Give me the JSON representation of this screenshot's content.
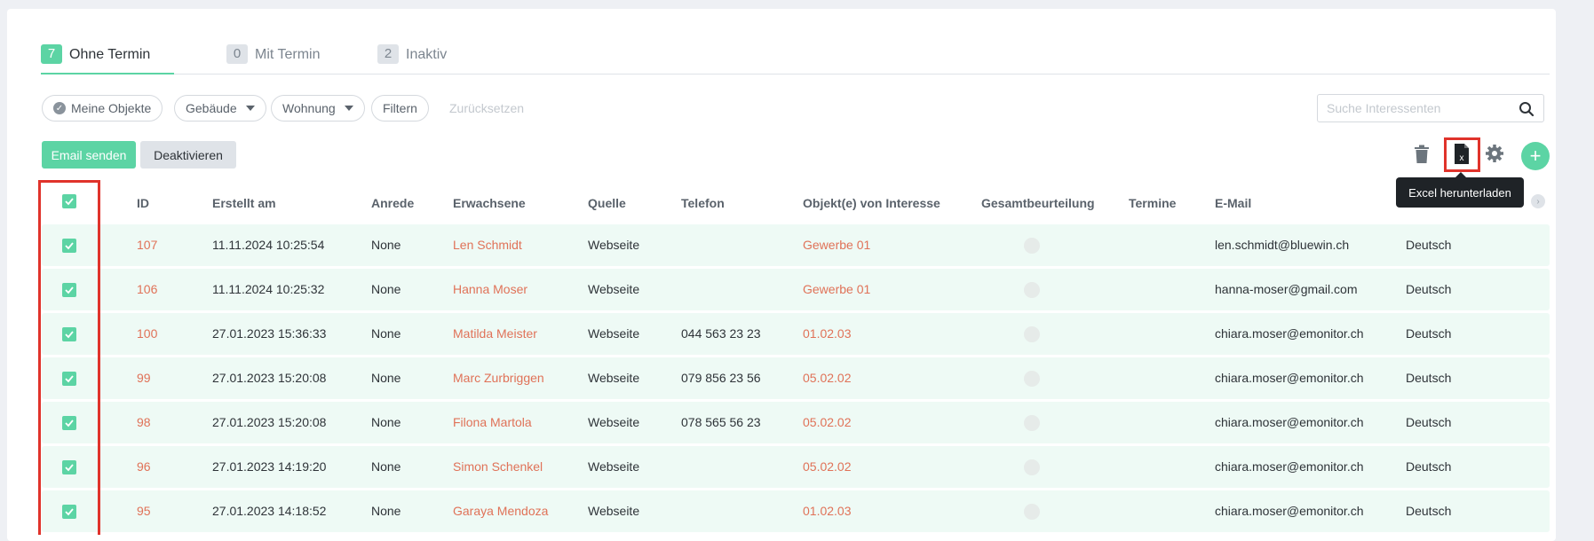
{
  "tabs": [
    {
      "count": "7",
      "label": "Ohne Termin",
      "active": true
    },
    {
      "count": "0",
      "label": "Mit Termin",
      "active": false
    },
    {
      "count": "2",
      "label": "Inaktiv",
      "active": false
    }
  ],
  "filters": {
    "my_objects": "Meine Objekte",
    "building": "Gebäude",
    "apartment": "Wohnung",
    "filter": "Filtern",
    "reset": "Zurücksetzen"
  },
  "search": {
    "placeholder": "Suche Interessenten",
    "value": ""
  },
  "actions": {
    "email": "Email senden",
    "deactivate": "Deaktivieren",
    "excel_tooltip": "Excel herunterladen"
  },
  "icons": {
    "delete": "trash-icon",
    "excel": "excel-file-icon",
    "settings": "gear-icon",
    "add": "plus-icon",
    "search": "search-icon"
  },
  "colors": {
    "accent": "#5cd4a4",
    "link": "#e07258",
    "highlight": "#e0332b",
    "row_bg": "#eefaf5"
  },
  "table": {
    "headers": [
      "ID",
      "Erstellt am",
      "Anrede",
      "Erwachsene",
      "Quelle",
      "Telefon",
      "Objekt(e) von Interesse",
      "Gesamtbeurteilung",
      "Termine",
      "E-Mail"
    ],
    "rows": [
      {
        "id": "107",
        "created": "11.11.2024 10:25:54",
        "salutation": "None",
        "adults": "Len Schmidt",
        "source": "Webseite",
        "phone": "",
        "objects": "Gewerbe 01",
        "appointments": "",
        "email": "len.schmidt@bluewin.ch",
        "language": "Deutsch"
      },
      {
        "id": "106",
        "created": "11.11.2024 10:25:32",
        "salutation": "None",
        "adults": "Hanna Moser",
        "source": "Webseite",
        "phone": "",
        "objects": "Gewerbe 01",
        "appointments": "",
        "email": "hanna-moser@gmail.com",
        "language": "Deutsch"
      },
      {
        "id": "100",
        "created": "27.01.2023 15:36:33",
        "salutation": "None",
        "adults": "Matilda Meister",
        "source": "Webseite",
        "phone": "044 563 23 23",
        "objects": "01.02.03",
        "appointments": "",
        "email": "chiara.moser@emonitor.ch",
        "language": "Deutsch"
      },
      {
        "id": "99",
        "created": "27.01.2023 15:20:08",
        "salutation": "None",
        "adults": "Marc Zurbriggen",
        "source": "Webseite",
        "phone": "079 856 23 56",
        "objects": "05.02.02",
        "appointments": "",
        "email": "chiara.moser@emonitor.ch",
        "language": "Deutsch"
      },
      {
        "id": "98",
        "created": "27.01.2023 15:20:08",
        "salutation": "None",
        "adults": "Filona Martola",
        "source": "Webseite",
        "phone": "078 565 56 23",
        "objects": "05.02.02",
        "appointments": "",
        "email": "chiara.moser@emonitor.ch",
        "language": "Deutsch"
      },
      {
        "id": "96",
        "created": "27.01.2023 14:19:20",
        "salutation": "None",
        "adults": "Simon Schenkel",
        "source": "Webseite",
        "phone": "",
        "objects": "05.02.02",
        "appointments": "",
        "email": "chiara.moser@emonitor.ch",
        "language": "Deutsch"
      },
      {
        "id": "95",
        "created": "27.01.2023 14:18:52",
        "salutation": "None",
        "adults": "Garaya Mendoza",
        "source": "Webseite",
        "phone": "",
        "objects": "01.02.03",
        "appointments": "",
        "email": "chiara.moser@emonitor.ch",
        "language": "Deutsch"
      }
    ]
  }
}
